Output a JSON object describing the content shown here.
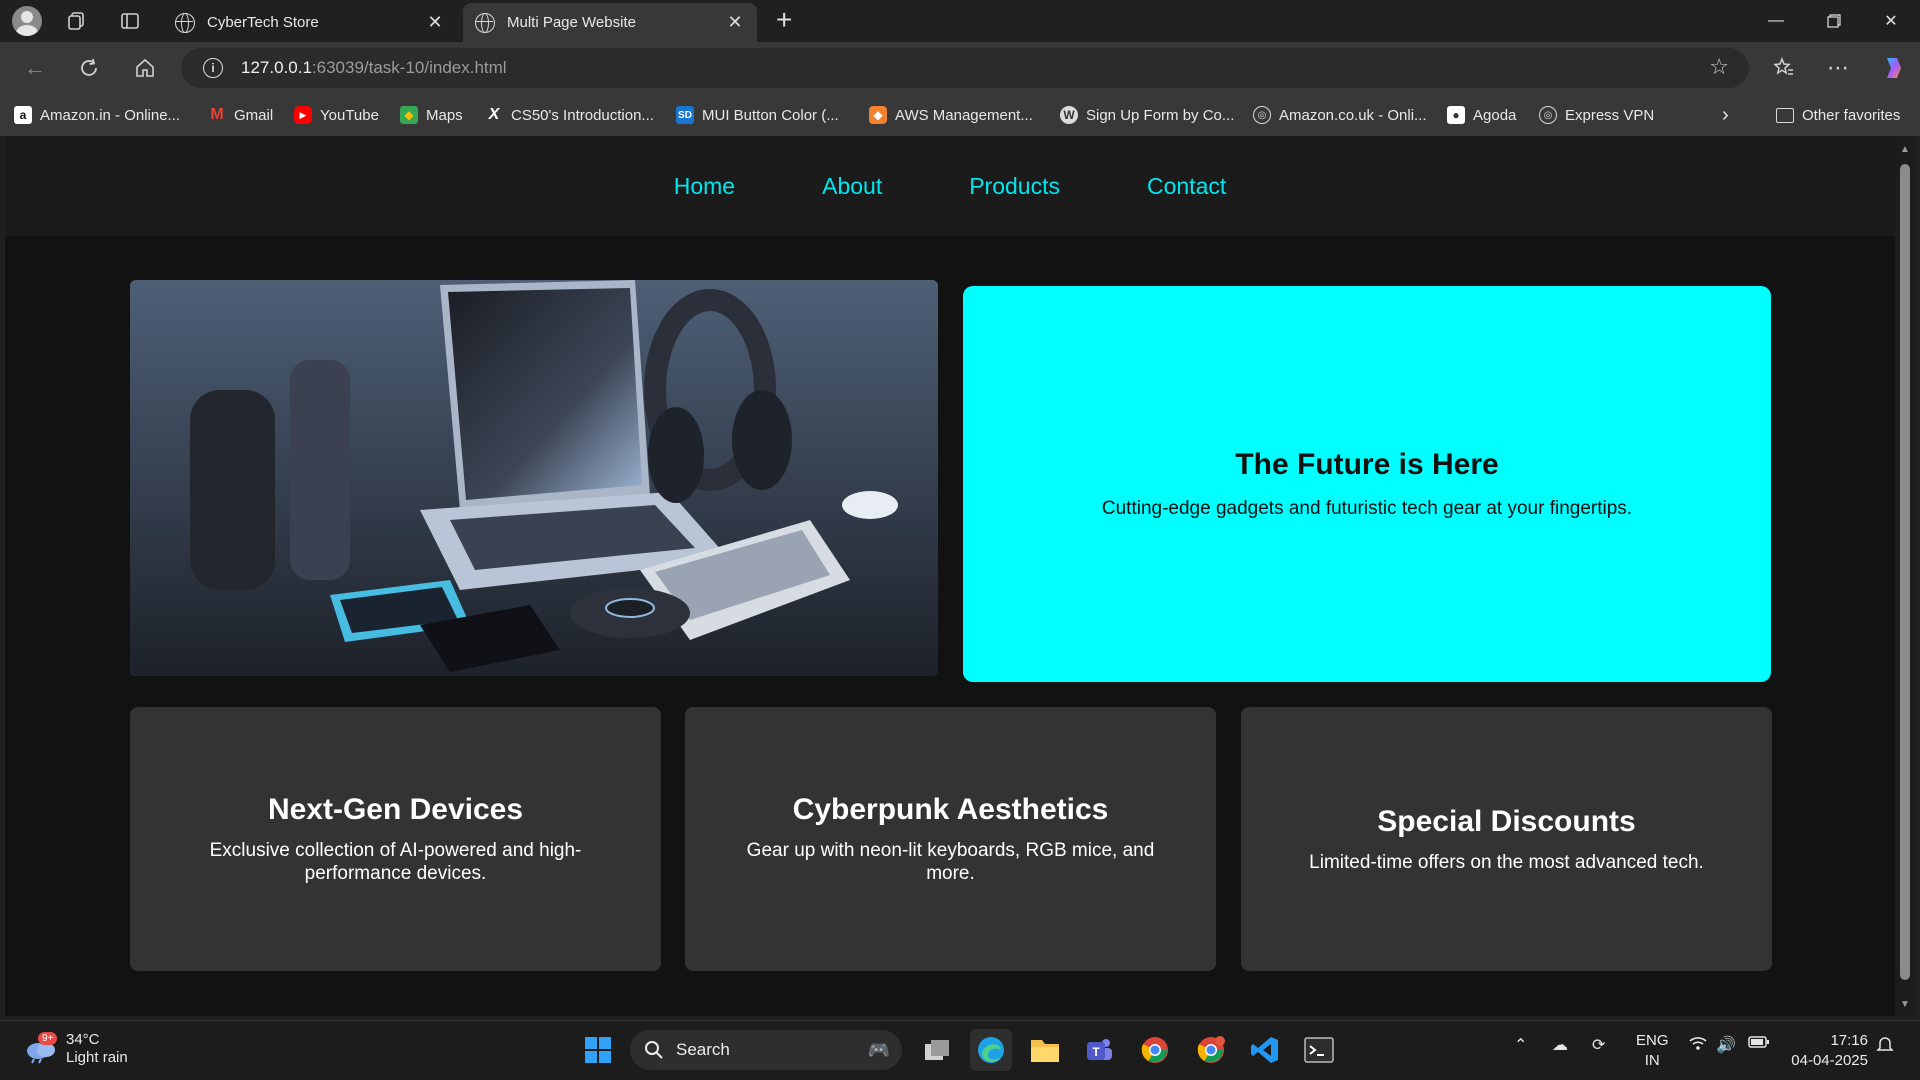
{
  "browser": {
    "tabs": [
      {
        "title": "CyberTech Store",
        "active": false
      },
      {
        "title": "Multi Page Website",
        "active": true
      }
    ],
    "url_host": "127.0.0.1",
    "url_path": ":63039/task-10/index.html",
    "bookmarks": [
      {
        "label": "Amazon.in - Online...",
        "icon": "amazon-icon"
      },
      {
        "label": "Gmail",
        "icon": "gmail-icon"
      },
      {
        "label": "YouTube",
        "icon": "youtube-icon"
      },
      {
        "label": "Maps",
        "icon": "maps-icon"
      },
      {
        "label": "CS50's Introduction...",
        "icon": "x-icon"
      },
      {
        "label": "MUI Button Color (...",
        "icon": "sd-icon"
      },
      {
        "label": "AWS Management...",
        "icon": "aws-icon"
      },
      {
        "label": "Sign Up Form by Co...",
        "icon": "wordpress-icon"
      },
      {
        "label": "Amazon.co.uk - Onli...",
        "icon": "globe-icon"
      },
      {
        "label": "Agoda",
        "icon": "agoda-icon"
      },
      {
        "label": "Express VPN",
        "icon": "globe-icon"
      }
    ],
    "other_favorites": "Other favorites"
  },
  "site": {
    "nav": [
      "Home",
      "About",
      "Products",
      "Contact"
    ],
    "hero": {
      "title": "The Future is Here",
      "subtitle": "Cutting-edge gadgets and futuristic tech gear at your fingertips."
    },
    "features": [
      {
        "title": "Next-Gen Devices",
        "text": "Exclusive collection of AI-powered and high-performance devices."
      },
      {
        "title": "Cyberpunk Aesthetics",
        "text": "Gear up with neon-lit keyboards, RGB mice, and more."
      },
      {
        "title": "Special Discounts",
        "text": "Limited-time offers on the most advanced tech."
      }
    ]
  },
  "taskbar": {
    "weather_badge": "9+",
    "temperature": "34°C",
    "condition": "Light rain",
    "search_label": "Search",
    "lang_top": "ENG",
    "lang_bottom": "IN",
    "time": "17:16",
    "date": "04-04-2025"
  },
  "colors": {
    "accent": "#00ffff",
    "nav_link": "#00e6ef",
    "card_bg": "#333333",
    "page_bg": "#121212"
  }
}
